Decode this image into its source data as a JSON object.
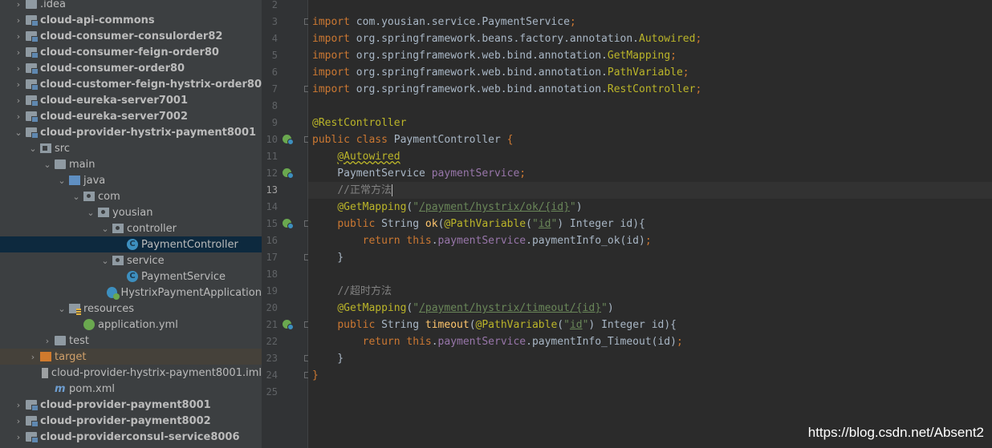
{
  "project_tree": [
    {
      "label": ".idea",
      "depth": 0,
      "expanded": false,
      "icon": "folder-icon",
      "bold": false
    },
    {
      "label": "cloud-api-commons",
      "depth": 0,
      "expanded": false,
      "icon": "module-icon",
      "bold": true
    },
    {
      "label": "cloud-consumer-consulorder82",
      "depth": 0,
      "expanded": false,
      "icon": "module-icon",
      "bold": true
    },
    {
      "label": "cloud-consumer-feign-order80",
      "depth": 0,
      "expanded": false,
      "icon": "module-icon",
      "bold": true
    },
    {
      "label": "cloud-consumer-order80",
      "depth": 0,
      "expanded": false,
      "icon": "module-icon",
      "bold": true
    },
    {
      "label": "cloud-customer-feign-hystrix-order80",
      "depth": 0,
      "expanded": false,
      "icon": "module-icon",
      "bold": true
    },
    {
      "label": "cloud-eureka-server7001",
      "depth": 0,
      "expanded": false,
      "icon": "module-icon",
      "bold": true
    },
    {
      "label": "cloud-eureka-server7002",
      "depth": 0,
      "expanded": false,
      "icon": "module-icon",
      "bold": true
    },
    {
      "label": "cloud-provider-hystrix-payment8001",
      "depth": 0,
      "expanded": true,
      "icon": "module-icon",
      "bold": true
    },
    {
      "label": "src",
      "depth": 1,
      "expanded": true,
      "icon": "src-folder-icon",
      "bold": false
    },
    {
      "label": "main",
      "depth": 2,
      "expanded": true,
      "icon": "folder-icon",
      "bold": false
    },
    {
      "label": "java",
      "depth": 3,
      "expanded": true,
      "icon": "java-folder-icon",
      "bold": false
    },
    {
      "label": "com",
      "depth": 4,
      "expanded": true,
      "icon": "package-icon",
      "bold": false
    },
    {
      "label": "yousian",
      "depth": 5,
      "expanded": true,
      "icon": "package-icon",
      "bold": false
    },
    {
      "label": "controller",
      "depth": 6,
      "expanded": true,
      "icon": "package-icon",
      "bold": false
    },
    {
      "label": "PaymentController",
      "depth": 7,
      "leaf": true,
      "icon": "class-icon",
      "selected": true
    },
    {
      "label": "service",
      "depth": 6,
      "expanded": true,
      "icon": "package-icon",
      "bold": false
    },
    {
      "label": "PaymentService",
      "depth": 7,
      "leaf": true,
      "icon": "class-icon"
    },
    {
      "label": "HystrixPaymentApplication",
      "depth": 6,
      "leaf": true,
      "icon": "spring-app-icon"
    },
    {
      "label": "resources",
      "depth": 3,
      "expanded": true,
      "icon": "resources-folder-icon",
      "bold": false
    },
    {
      "label": "application.yml",
      "depth": 4,
      "leaf": true,
      "icon": "yaml-icon"
    },
    {
      "label": "test",
      "depth": 2,
      "expanded": false,
      "icon": "folder-icon",
      "bold": false
    },
    {
      "label": "target",
      "depth": 1,
      "expanded": false,
      "icon": "target-folder-icon",
      "excluded": true
    },
    {
      "label": "cloud-provider-hystrix-payment8001.iml",
      "depth": 2,
      "leaf": true,
      "icon": "iml-file-icon"
    },
    {
      "label": "pom.xml",
      "depth": 2,
      "leaf": true,
      "icon": "maven-icon"
    },
    {
      "label": "cloud-provider-payment8001",
      "depth": 0,
      "expanded": false,
      "icon": "module-icon",
      "bold": true
    },
    {
      "label": "cloud-provider-payment8002",
      "depth": 0,
      "expanded": false,
      "icon": "module-icon",
      "bold": true
    },
    {
      "label": "cloud-providerconsul-service8006",
      "depth": 0,
      "expanded": false,
      "icon": "module-icon",
      "bold": true
    }
  ],
  "editor": {
    "current_line": 13,
    "lines": [
      {
        "n": 2,
        "tokens": []
      },
      {
        "n": 3,
        "fold": true,
        "tokens": [
          {
            "t": "import ",
            "c": "kw"
          },
          {
            "t": "com.yousian.service.PaymentService"
          },
          {
            "t": ";",
            "c": "kw"
          }
        ]
      },
      {
        "n": 4,
        "tokens": [
          {
            "t": "import ",
            "c": "kw"
          },
          {
            "t": "org.springframework.beans.factory.annotation."
          },
          {
            "t": "Autowired",
            "c": "ann"
          },
          {
            "t": ";",
            "c": "kw"
          }
        ]
      },
      {
        "n": 5,
        "tokens": [
          {
            "t": "import ",
            "c": "kw"
          },
          {
            "t": "org.springframework.web.bind.annotation."
          },
          {
            "t": "GetMapping",
            "c": "ann"
          },
          {
            "t": ";",
            "c": "kw"
          }
        ]
      },
      {
        "n": 6,
        "tokens": [
          {
            "t": "import ",
            "c": "kw"
          },
          {
            "t": "org.springframework.web.bind.annotation."
          },
          {
            "t": "PathVariable",
            "c": "ann"
          },
          {
            "t": ";",
            "c": "kw"
          }
        ]
      },
      {
        "n": 7,
        "fold": true,
        "tokens": [
          {
            "t": "import ",
            "c": "kw"
          },
          {
            "t": "org.springframework.web.bind.annotation."
          },
          {
            "t": "RestController",
            "c": "ann"
          },
          {
            "t": ";",
            "c": "kw"
          }
        ]
      },
      {
        "n": 8,
        "tokens": []
      },
      {
        "n": 9,
        "tokens": [
          {
            "t": "@RestController",
            "c": "ann"
          }
        ]
      },
      {
        "n": 10,
        "bean": true,
        "fold": true,
        "tokens": [
          {
            "t": "public class ",
            "c": "kw"
          },
          {
            "t": "PaymentController "
          },
          {
            "t": "{",
            "c": "kw"
          }
        ]
      },
      {
        "n": 11,
        "tokens": [
          {
            "t": "    "
          },
          {
            "t": "@Autowired",
            "c": "ann warn"
          }
        ]
      },
      {
        "n": 12,
        "bean": true,
        "tokens": [
          {
            "t": "    PaymentService "
          },
          {
            "t": "paymentService",
            "c": "field"
          },
          {
            "t": ";",
            "c": "kw"
          }
        ]
      },
      {
        "n": 13,
        "caret": true,
        "tokens": [
          {
            "t": "    "
          },
          {
            "t": "//正常方法",
            "c": "cmt"
          }
        ]
      },
      {
        "n": 14,
        "tokens": [
          {
            "t": "    "
          },
          {
            "t": "@GetMapping",
            "c": "ann"
          },
          {
            "t": "("
          },
          {
            "t": "\"",
            "c": "str"
          },
          {
            "t": "/payment/hystrix/ok/{id}",
            "c": "str u"
          },
          {
            "t": "\"",
            "c": "str"
          },
          {
            "t": ")"
          }
        ]
      },
      {
        "n": 15,
        "bean": true,
        "fold": true,
        "tokens": [
          {
            "t": "    "
          },
          {
            "t": "public ",
            "c": "kw"
          },
          {
            "t": "String "
          },
          {
            "t": "ok",
            "c": "fn"
          },
          {
            "t": "("
          },
          {
            "t": "@PathVariable",
            "c": "ann"
          },
          {
            "t": "("
          },
          {
            "t": "\"",
            "c": "str"
          },
          {
            "t": "id",
            "c": "str u"
          },
          {
            "t": "\"",
            "c": "str"
          },
          {
            "t": ") Integer id){"
          }
        ]
      },
      {
        "n": 16,
        "tokens": [
          {
            "t": "        "
          },
          {
            "t": "return this",
            "c": "kw"
          },
          {
            "t": "."
          },
          {
            "t": "paymentService",
            "c": "field"
          },
          {
            "t": ".paymentInfo_ok(id)"
          },
          {
            "t": ";",
            "c": "kw"
          }
        ]
      },
      {
        "n": 17,
        "fold": true,
        "tokens": [
          {
            "t": "    }"
          }
        ]
      },
      {
        "n": 18,
        "tokens": []
      },
      {
        "n": 19,
        "tokens": [
          {
            "t": "    "
          },
          {
            "t": "//超时方法",
            "c": "cmt"
          }
        ]
      },
      {
        "n": 20,
        "tokens": [
          {
            "t": "    "
          },
          {
            "t": "@GetMapping",
            "c": "ann"
          },
          {
            "t": "("
          },
          {
            "t": "\"",
            "c": "str"
          },
          {
            "t": "/payment/hystrix/timeout/{id}",
            "c": "str u"
          },
          {
            "t": "\"",
            "c": "str"
          },
          {
            "t": ")"
          }
        ]
      },
      {
        "n": 21,
        "bean": true,
        "fold": true,
        "tokens": [
          {
            "t": "    "
          },
          {
            "t": "public ",
            "c": "kw"
          },
          {
            "t": "String "
          },
          {
            "t": "timeout",
            "c": "fn"
          },
          {
            "t": "("
          },
          {
            "t": "@PathVariable",
            "c": "ann"
          },
          {
            "t": "("
          },
          {
            "t": "\"",
            "c": "str"
          },
          {
            "t": "id",
            "c": "str u"
          },
          {
            "t": "\"",
            "c": "str"
          },
          {
            "t": ") Integer id){"
          }
        ]
      },
      {
        "n": 22,
        "tokens": [
          {
            "t": "        "
          },
          {
            "t": "return this",
            "c": "kw"
          },
          {
            "t": "."
          },
          {
            "t": "paymentService",
            "c": "field"
          },
          {
            "t": ".paymentInfo_Timeout(id)"
          },
          {
            "t": ";",
            "c": "kw"
          }
        ]
      },
      {
        "n": 23,
        "fold": true,
        "tokens": [
          {
            "t": "    }"
          }
        ]
      },
      {
        "n": 24,
        "fold": true,
        "tokens": [
          {
            "t": "}",
            "c": "kw"
          }
        ]
      },
      {
        "n": 25,
        "tokens": []
      }
    ]
  },
  "watermark": "https://blog.csdn.net/Absent2",
  "colors": {
    "sidebar_bg": "#3c3f41",
    "editor_bg": "#2b2b2b",
    "gutter_bg": "#313335",
    "selection": "#0d293e",
    "keyword": "#cc7832",
    "annotation": "#bbb529",
    "string": "#6a8759",
    "field": "#9876aa",
    "method": "#ffc66d",
    "comment": "#808080"
  }
}
